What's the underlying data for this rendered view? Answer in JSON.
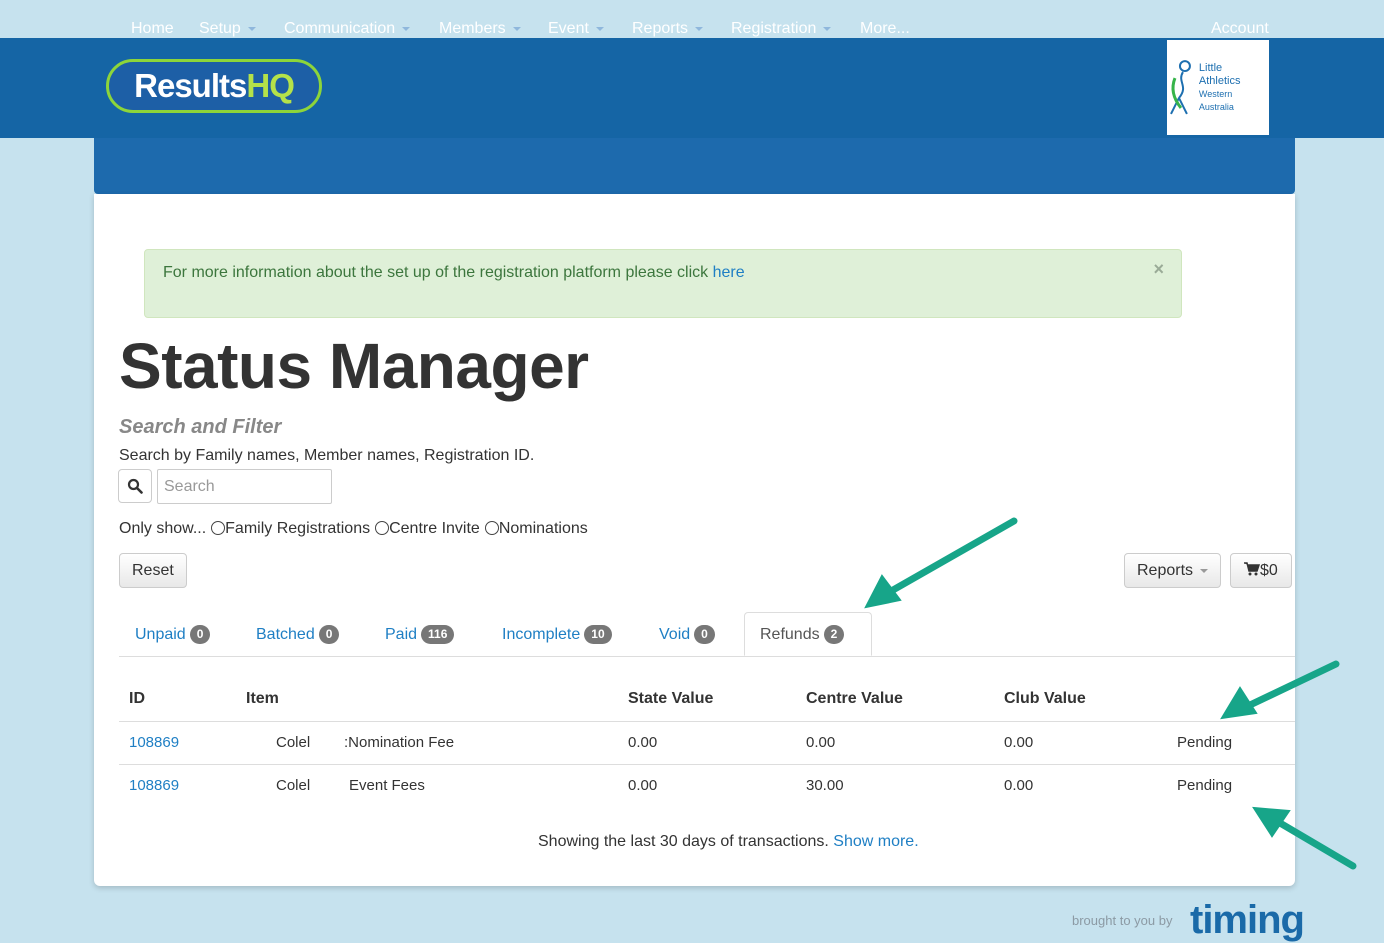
{
  "header": {
    "logo_main": "Results",
    "logo_hq": "HQ",
    "partner_logo": {
      "line1": "Little",
      "line2": "Athletics",
      "line3": "Western Australia"
    }
  },
  "nav": {
    "items": [
      {
        "label": "Home"
      },
      {
        "label": "Setup"
      },
      {
        "label": "Communication"
      },
      {
        "label": "Members"
      },
      {
        "label": "Event"
      },
      {
        "label": "Reports"
      },
      {
        "label": "Registration"
      },
      {
        "label": "More..."
      }
    ],
    "account": "Account"
  },
  "alert": {
    "text": "For more information about the set up of the registration platform please click ",
    "link": "here",
    "close": "×"
  },
  "page": {
    "title": "Status Manager",
    "subtitle": "Search and Filter",
    "help": "Search by Family names, Member names, Registration ID."
  },
  "search": {
    "placeholder": "Search"
  },
  "filters": {
    "label": "Only show...",
    "options": [
      "Family Registrations",
      "Centre Invite",
      "Nominations"
    ]
  },
  "buttons": {
    "reset": "Reset",
    "reports": "Reports",
    "cart": "$0"
  },
  "tabs": [
    {
      "label": "Unpaid",
      "count": "0"
    },
    {
      "label": "Batched",
      "count": "0"
    },
    {
      "label": "Paid",
      "count": "116"
    },
    {
      "label": "Incomplete",
      "count": "10"
    },
    {
      "label": "Void",
      "count": "0"
    },
    {
      "label": "Refunds",
      "count": "2"
    }
  ],
  "table": {
    "headers": [
      "ID",
      "Item",
      "State Value",
      "Centre Value",
      "Club Value"
    ],
    "rows": [
      {
        "id": "108869",
        "name": "Colel",
        "item": ":Nomination Fee",
        "state": "0.00",
        "centre": "0.00",
        "club": "0.00",
        "status": "Pending"
      },
      {
        "id": "108869",
        "name": "Colel",
        "item": "Event Fees",
        "state": "0.00",
        "centre": "30.00",
        "club": "0.00",
        "status": "Pending"
      }
    ]
  },
  "footer": {
    "note": "Showing the last 30 days of transactions. ",
    "link": "Show more.",
    "brought": "brought to you by",
    "brand": "timing"
  },
  "colors": {
    "header_bg": "#1565a5",
    "nav_bg": "#1d6aad",
    "link": "#1f7fc4",
    "alert_bg": "#dff0d8",
    "arrow": "#17a589"
  }
}
